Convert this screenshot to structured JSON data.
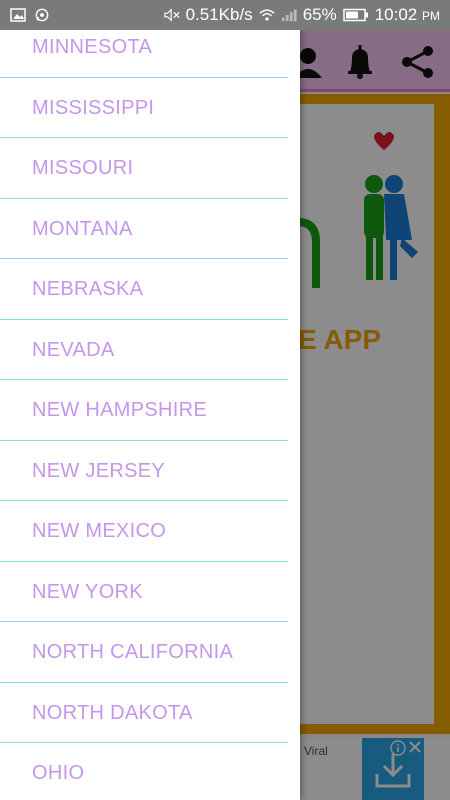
{
  "status_bar": {
    "network_speed": "0.51Kb/s",
    "battery": "65%",
    "time": "10:02",
    "ampm": "PM",
    "icons": [
      "image-icon",
      "whatsapp-icon",
      "mute-icon",
      "wifi-icon",
      "signal-icon",
      "battery-icon"
    ]
  },
  "toolbar": {
    "icons": [
      "profile-icon",
      "bell-icon",
      "share-icon"
    ]
  },
  "background": {
    "title_fragment": "E APP",
    "ad_label": "Viral"
  },
  "drawer": {
    "items": [
      {
        "label": "MINNESOTA"
      },
      {
        "label": "MISSISSIPPI"
      },
      {
        "label": "MISSOURI"
      },
      {
        "label": "MONTANA"
      },
      {
        "label": "NEBRASKA"
      },
      {
        "label": "NEVADA"
      },
      {
        "label": "NEW HAMPSHIRE"
      },
      {
        "label": "NEW JERSEY"
      },
      {
        "label": "NEW MEXICO"
      },
      {
        "label": "NEW YORK"
      },
      {
        "label": "NORTH CALIFORNIA"
      },
      {
        "label": "NORTH DAKOTA"
      },
      {
        "label": "OHIO"
      }
    ]
  },
  "colors": {
    "item_text": "#c596ea",
    "divider": "#7fe3e8",
    "accent": "#f5a800",
    "status_bar": "#7a7a7a"
  }
}
